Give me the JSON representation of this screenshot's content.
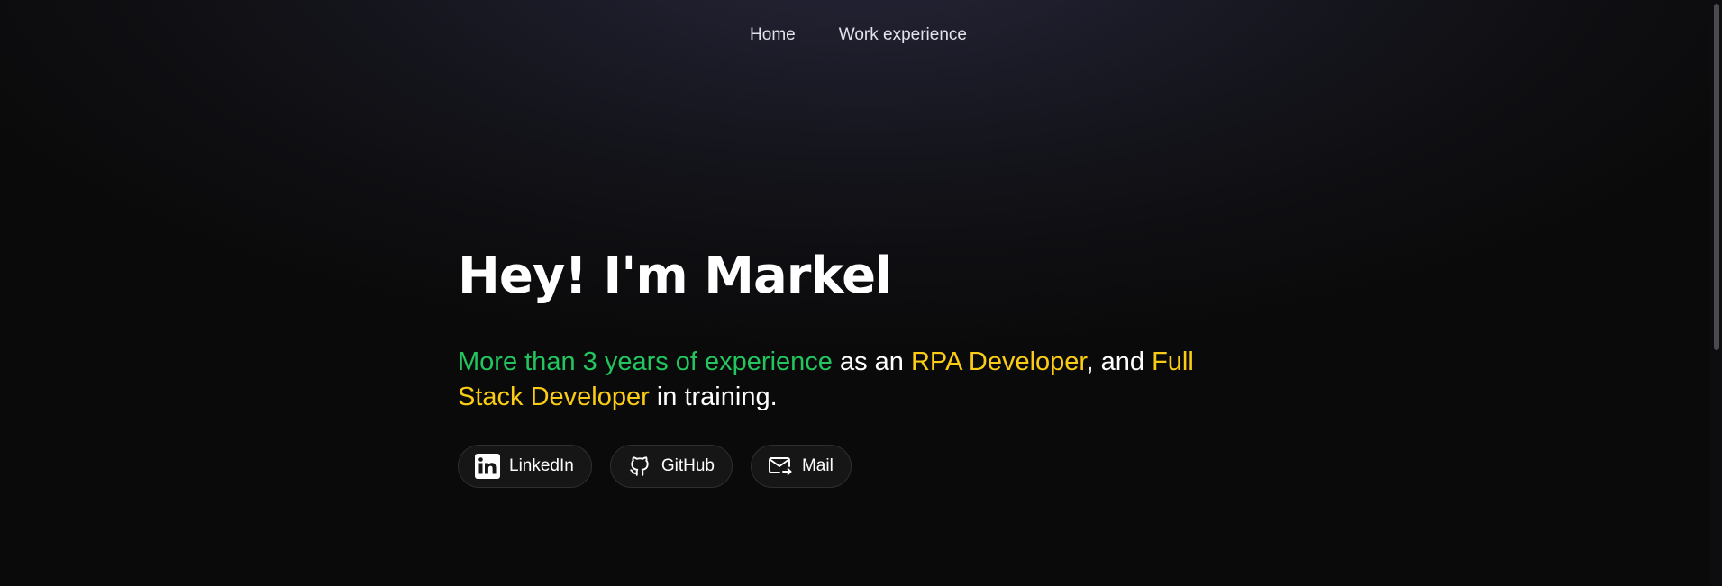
{
  "nav": {
    "items": [
      {
        "label": "Home"
      },
      {
        "label": "Work experience"
      }
    ]
  },
  "hero": {
    "title": "Hey! I'm Markel",
    "tagline": {
      "part1": "More than 3 years of experience",
      "part2": " as an ",
      "part3": "RPA Developer",
      "part4": ", and ",
      "part5": "Full Stack Developer",
      "part6": " in training."
    }
  },
  "socials": [
    {
      "label": "LinkedIn",
      "icon": "linkedin-icon"
    },
    {
      "label": "GitHub",
      "icon": "github-icon"
    },
    {
      "label": "Mail",
      "icon": "mail-icon"
    }
  ],
  "colors": {
    "highlight_green": "#22c55e",
    "highlight_yellow": "#facc15",
    "background": "#0a0a0a"
  }
}
